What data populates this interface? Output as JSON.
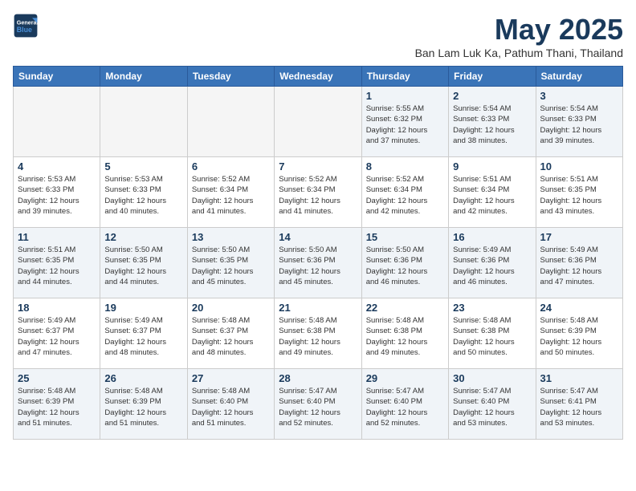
{
  "logo": {
    "line1": "General",
    "line2": "Blue"
  },
  "title": "May 2025",
  "subtitle": "Ban Lam Luk Ka, Pathum Thani, Thailand",
  "headers": [
    "Sunday",
    "Monday",
    "Tuesday",
    "Wednesday",
    "Thursday",
    "Friday",
    "Saturday"
  ],
  "weeks": [
    [
      {
        "num": "",
        "info": "",
        "empty": true
      },
      {
        "num": "",
        "info": "",
        "empty": true
      },
      {
        "num": "",
        "info": "",
        "empty": true
      },
      {
        "num": "",
        "info": "",
        "empty": true
      },
      {
        "num": "1",
        "info": "Sunrise: 5:55 AM\nSunset: 6:32 PM\nDaylight: 12 hours\nand 37 minutes."
      },
      {
        "num": "2",
        "info": "Sunrise: 5:54 AM\nSunset: 6:33 PM\nDaylight: 12 hours\nand 38 minutes."
      },
      {
        "num": "3",
        "info": "Sunrise: 5:54 AM\nSunset: 6:33 PM\nDaylight: 12 hours\nand 39 minutes."
      }
    ],
    [
      {
        "num": "4",
        "info": "Sunrise: 5:53 AM\nSunset: 6:33 PM\nDaylight: 12 hours\nand 39 minutes."
      },
      {
        "num": "5",
        "info": "Sunrise: 5:53 AM\nSunset: 6:33 PM\nDaylight: 12 hours\nand 40 minutes."
      },
      {
        "num": "6",
        "info": "Sunrise: 5:52 AM\nSunset: 6:34 PM\nDaylight: 12 hours\nand 41 minutes."
      },
      {
        "num": "7",
        "info": "Sunrise: 5:52 AM\nSunset: 6:34 PM\nDaylight: 12 hours\nand 41 minutes."
      },
      {
        "num": "8",
        "info": "Sunrise: 5:52 AM\nSunset: 6:34 PM\nDaylight: 12 hours\nand 42 minutes."
      },
      {
        "num": "9",
        "info": "Sunrise: 5:51 AM\nSunset: 6:34 PM\nDaylight: 12 hours\nand 42 minutes."
      },
      {
        "num": "10",
        "info": "Sunrise: 5:51 AM\nSunset: 6:35 PM\nDaylight: 12 hours\nand 43 minutes."
      }
    ],
    [
      {
        "num": "11",
        "info": "Sunrise: 5:51 AM\nSunset: 6:35 PM\nDaylight: 12 hours\nand 44 minutes."
      },
      {
        "num": "12",
        "info": "Sunrise: 5:50 AM\nSunset: 6:35 PM\nDaylight: 12 hours\nand 44 minutes."
      },
      {
        "num": "13",
        "info": "Sunrise: 5:50 AM\nSunset: 6:35 PM\nDaylight: 12 hours\nand 45 minutes."
      },
      {
        "num": "14",
        "info": "Sunrise: 5:50 AM\nSunset: 6:36 PM\nDaylight: 12 hours\nand 45 minutes."
      },
      {
        "num": "15",
        "info": "Sunrise: 5:50 AM\nSunset: 6:36 PM\nDaylight: 12 hours\nand 46 minutes."
      },
      {
        "num": "16",
        "info": "Sunrise: 5:49 AM\nSunset: 6:36 PM\nDaylight: 12 hours\nand 46 minutes."
      },
      {
        "num": "17",
        "info": "Sunrise: 5:49 AM\nSunset: 6:36 PM\nDaylight: 12 hours\nand 47 minutes."
      }
    ],
    [
      {
        "num": "18",
        "info": "Sunrise: 5:49 AM\nSunset: 6:37 PM\nDaylight: 12 hours\nand 47 minutes."
      },
      {
        "num": "19",
        "info": "Sunrise: 5:49 AM\nSunset: 6:37 PM\nDaylight: 12 hours\nand 48 minutes."
      },
      {
        "num": "20",
        "info": "Sunrise: 5:48 AM\nSunset: 6:37 PM\nDaylight: 12 hours\nand 48 minutes."
      },
      {
        "num": "21",
        "info": "Sunrise: 5:48 AM\nSunset: 6:38 PM\nDaylight: 12 hours\nand 49 minutes."
      },
      {
        "num": "22",
        "info": "Sunrise: 5:48 AM\nSunset: 6:38 PM\nDaylight: 12 hours\nand 49 minutes."
      },
      {
        "num": "23",
        "info": "Sunrise: 5:48 AM\nSunset: 6:38 PM\nDaylight: 12 hours\nand 50 minutes."
      },
      {
        "num": "24",
        "info": "Sunrise: 5:48 AM\nSunset: 6:39 PM\nDaylight: 12 hours\nand 50 minutes."
      }
    ],
    [
      {
        "num": "25",
        "info": "Sunrise: 5:48 AM\nSunset: 6:39 PM\nDaylight: 12 hours\nand 51 minutes."
      },
      {
        "num": "26",
        "info": "Sunrise: 5:48 AM\nSunset: 6:39 PM\nDaylight: 12 hours\nand 51 minutes."
      },
      {
        "num": "27",
        "info": "Sunrise: 5:48 AM\nSunset: 6:40 PM\nDaylight: 12 hours\nand 51 minutes."
      },
      {
        "num": "28",
        "info": "Sunrise: 5:47 AM\nSunset: 6:40 PM\nDaylight: 12 hours\nand 52 minutes."
      },
      {
        "num": "29",
        "info": "Sunrise: 5:47 AM\nSunset: 6:40 PM\nDaylight: 12 hours\nand 52 minutes."
      },
      {
        "num": "30",
        "info": "Sunrise: 5:47 AM\nSunset: 6:40 PM\nDaylight: 12 hours\nand 53 minutes."
      },
      {
        "num": "31",
        "info": "Sunrise: 5:47 AM\nSunset: 6:41 PM\nDaylight: 12 hours\nand 53 minutes."
      }
    ]
  ]
}
